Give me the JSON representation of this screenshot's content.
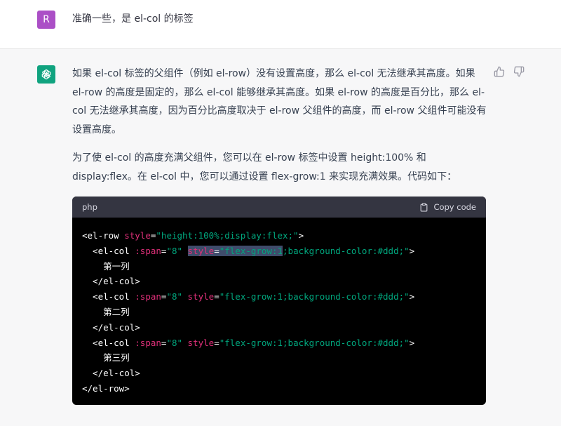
{
  "user": {
    "avatar_letter": "R",
    "message": "准确一些，是 el-col 的标签"
  },
  "assistant": {
    "paragraphs": [
      "如果 el-col 标签的父组件（例如 el-row）没有设置高度，那么 el-col 无法继承其高度。如果 el-row 的高度是固定的，那么 el-col 能够继承其高度。如果 el-row 的高度是百分比，那么 el-col 无法继承其高度，因为百分比高度取决于 el-row 父组件的高度，而 el-row 父组件可能没有设置高度。",
      "为了使 el-col 的高度充满父组件，您可以在 el-row 标签中设置 height:100% 和 display:flex。在 el-col 中，您可以通过设置 flex-grow:1 来实现充满效果。代码如下："
    ],
    "code": {
      "language": "php",
      "copy_label": "Copy code",
      "lines": [
        [
          {
            "t": "tag",
            "v": "<el-row "
          },
          {
            "t": "attr",
            "v": "style"
          },
          {
            "t": "plain",
            "v": "="
          },
          {
            "t": "str",
            "v": "\"height:100%;display:flex;\""
          },
          {
            "t": "tag",
            "v": ">"
          }
        ],
        [
          {
            "t": "tag",
            "v": "  <el-col "
          },
          {
            "t": "attr",
            "v": ":span"
          },
          {
            "t": "plain",
            "v": "="
          },
          {
            "t": "str",
            "v": "\"8\""
          },
          {
            "t": "plain",
            "v": " "
          },
          {
            "t": "attr",
            "v": "style",
            "sel": true
          },
          {
            "t": "plain",
            "v": "=",
            "sel": true
          },
          {
            "t": "str",
            "v": "\"flex-grow:1",
            "sel": true
          },
          {
            "t": "str",
            "v": ";background-color:#ddd;\""
          },
          {
            "t": "tag",
            "v": ">"
          }
        ],
        [
          {
            "t": "plain",
            "v": "    第一列"
          }
        ],
        [
          {
            "t": "tag",
            "v": "  </el-col>"
          }
        ],
        [
          {
            "t": "tag",
            "v": "  <el-col "
          },
          {
            "t": "attr",
            "v": ":span"
          },
          {
            "t": "plain",
            "v": "="
          },
          {
            "t": "str",
            "v": "\"8\""
          },
          {
            "t": "plain",
            "v": " "
          },
          {
            "t": "attr",
            "v": "style"
          },
          {
            "t": "plain",
            "v": "="
          },
          {
            "t": "str",
            "v": "\"flex-grow:1;background-color:#ddd;\""
          },
          {
            "t": "tag",
            "v": ">"
          }
        ],
        [
          {
            "t": "plain",
            "v": "    第二列"
          }
        ],
        [
          {
            "t": "tag",
            "v": "  </el-col>"
          }
        ],
        [
          {
            "t": "tag",
            "v": "  <el-col "
          },
          {
            "t": "attr",
            "v": ":span"
          },
          {
            "t": "plain",
            "v": "="
          },
          {
            "t": "str",
            "v": "\"8\""
          },
          {
            "t": "plain",
            "v": " "
          },
          {
            "t": "attr",
            "v": "style"
          },
          {
            "t": "plain",
            "v": "="
          },
          {
            "t": "str",
            "v": "\"flex-grow:1;background-color:#ddd;\""
          },
          {
            "t": "tag",
            "v": ">"
          }
        ],
        [
          {
            "t": "plain",
            "v": "    第三列"
          }
        ],
        [
          {
            "t": "tag",
            "v": "  </el-col>"
          }
        ],
        [
          {
            "t": "tag",
            "v": "</el-row>"
          }
        ]
      ]
    }
  },
  "icons": {
    "bot_avatar": "openai-logo-icon",
    "thumbs_up": "thumbs-up-icon",
    "thumbs_down": "thumbs-down-icon",
    "copy": "clipboard-icon"
  },
  "colors": {
    "user_avatar": "#ab4fc6",
    "bot_avatar": "#10a37f",
    "code_bg": "#000000",
    "code_header_bg": "#343541",
    "syntax_attr": "#df3079",
    "syntax_string": "#00a67d"
  }
}
